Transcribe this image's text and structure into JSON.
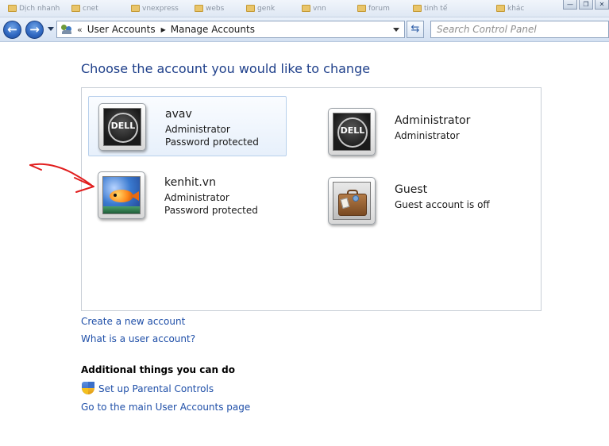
{
  "window": {
    "minimize_glyph": "—",
    "restore_glyph": "❐",
    "close_glyph": "✕"
  },
  "bookmarks": [
    "Dịch nhanh",
    "cnet",
    "vnexpress",
    "webs",
    "genk",
    "vnn",
    "forum",
    "tinh tế",
    "khác"
  ],
  "nav": {
    "back_glyph": "←",
    "forward_glyph": "→",
    "address": {
      "chevron": "«",
      "crumbs": [
        "User Accounts",
        "Manage Accounts"
      ],
      "separator": "▶"
    },
    "refresh_glyph": "⇆",
    "search_placeholder": "Search Control Panel"
  },
  "heading": "Choose the account you would like to change",
  "accounts": [
    {
      "name": "avav",
      "lines": [
        "Administrator",
        "Password protected"
      ],
      "picture": "dell-logo",
      "selected": true
    },
    {
      "name": "Administrator",
      "lines": [
        "Administrator"
      ],
      "picture": "dell-logo",
      "selected": false
    },
    {
      "name": "kenhit.vn",
      "lines": [
        "Administrator",
        "Password protected"
      ],
      "picture": "fish",
      "selected": false
    },
    {
      "name": "Guest",
      "lines": [
        "Guest account is off"
      ],
      "picture": "briefcase",
      "selected": false
    }
  ],
  "dell_logo_text": "DELL",
  "links": {
    "create_account": "Create a new account",
    "what_is": "What is a user account?"
  },
  "additional": {
    "title": "Additional things you can do",
    "parental_controls": "Set up Parental Controls",
    "main_page": "Go to the main User Accounts page"
  },
  "annotation_color": "#e11d1d"
}
